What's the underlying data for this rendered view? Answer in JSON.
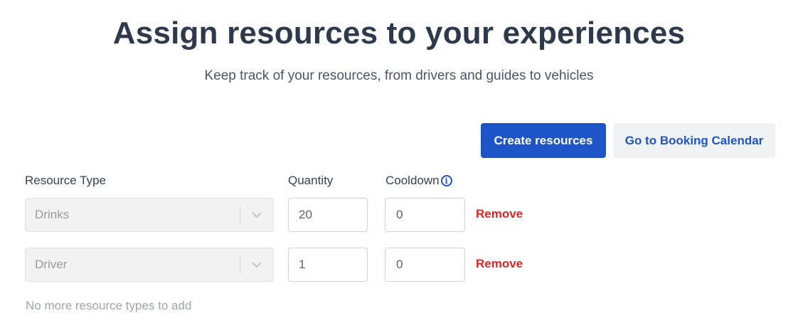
{
  "header": {
    "title": "Assign resources to your experiences",
    "subtitle": "Keep track of your resources, from drivers and guides to vehicles"
  },
  "actions": {
    "create_label": "Create resources",
    "calendar_label": "Go to Booking Calendar"
  },
  "columns": {
    "type": "Resource Type",
    "quantity": "Quantity",
    "cooldown": "Cooldown"
  },
  "rows": [
    {
      "type": "Drinks",
      "quantity": "20",
      "cooldown": "0",
      "remove_label": "Remove"
    },
    {
      "type": "Driver",
      "quantity": "1",
      "cooldown": "0",
      "remove_label": "Remove"
    }
  ],
  "footer_note": "No more resource types to add",
  "colors": {
    "primary": "#1d55c9",
    "danger": "#e02424",
    "title": "#2e3a4b"
  }
}
